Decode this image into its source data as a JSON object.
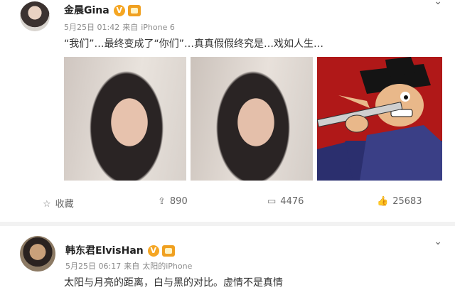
{
  "post1": {
    "name": "金晨Gina",
    "verified_mark": "V",
    "date": "5月25日 01:42",
    "source_prefix": "来自",
    "device": "iPhone 6",
    "text": "“我们”…最终变成了“你们”…真真假假终究是…戏如人生…",
    "actions": {
      "favorite_label": "收藏",
      "repost_count": "890",
      "comment_count": "4476",
      "like_count": "25683"
    }
  },
  "post2": {
    "name": "韩东君ElvisHan",
    "verified_mark": "V",
    "date": "5月25日 06:17",
    "source_prefix": "来自",
    "device": "太阳的iPhone",
    "text": "太阳与月亮的距离，白与黑的对比。虚情不是真情"
  },
  "icons": {
    "menu": "chevron-down-icon",
    "favorite": "star-icon",
    "repost": "repost-icon",
    "comment": "comment-icon",
    "like": "thumbs-up-icon"
  },
  "colors": {
    "verified": "#f5a623",
    "meta_text": "#8a8a8a",
    "comic_background": "#b01818"
  }
}
